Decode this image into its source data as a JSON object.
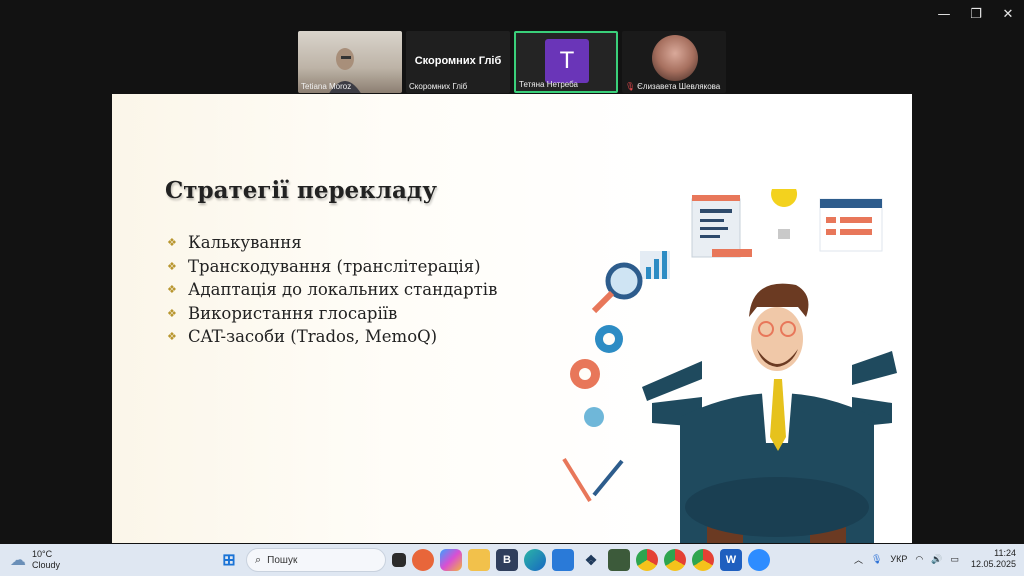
{
  "window": {
    "controls": {
      "minimize": "—",
      "restore": "❐",
      "close": "✕"
    }
  },
  "participants": [
    {
      "name": "Tetiana Moroz",
      "type": "camera"
    },
    {
      "name": "Скоромних Гліб",
      "display": "Скоромних Гліб",
      "type": "name"
    },
    {
      "name": "Тетяна Нетреба",
      "initial": "T",
      "type": "avatar",
      "active": true
    },
    {
      "name": "Єлизавета Шевлякова",
      "type": "camera",
      "muted": true
    }
  ],
  "slide": {
    "title": "Стратегії перекладу",
    "bullets": [
      "Калькування",
      "Транскодування (транслітерація)",
      "Адаптація до локальних стандартів",
      "Використання глосаріїв",
      "CAT-засоби (Trados, MemoQ)"
    ]
  },
  "taskbar": {
    "weather": {
      "temp": "10°C",
      "condition": "Cloudy"
    },
    "search_placeholder": "Пошук",
    "language": "УКР",
    "time": "11:24",
    "date": "12.05.2025",
    "pinned": [
      "windows-start-icon",
      "search",
      "task-view-icon",
      "firefox-icon",
      "copilot-icon",
      "file-explorer-icon",
      "b-app-icon",
      "edge-icon",
      "store-icon",
      "dropbox-icon",
      "app-icon",
      "chrome-icon",
      "chrome-icon",
      "chrome-icon",
      "word-icon",
      "zoom-icon"
    ]
  },
  "colors": {
    "accent": "#3ad07a",
    "avatar": "#6a35b8",
    "bullet": "#b8962e"
  }
}
